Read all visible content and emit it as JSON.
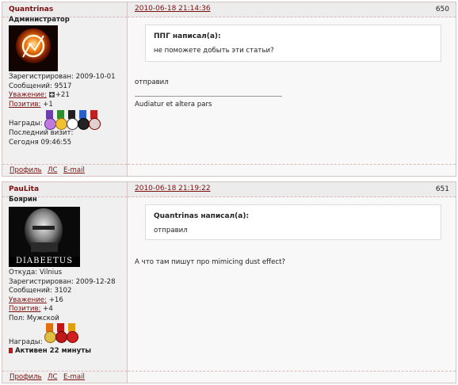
{
  "posts": [
    {
      "username": "Quantrinas",
      "rank": "Администратор",
      "date": "2010-06-18 21:14:36",
      "number": "650",
      "info": {
        "registered": "Зарегистрирован: 2009-10-01",
        "messages": "Сообщений: 9517",
        "respect_label": "Уважение:",
        "respect_value": "+21",
        "positive_label": "Позитив:",
        "positive_value": "+1",
        "awards": "Награды:",
        "last_visit_label": "Последний визит:",
        "last_visit_value": "Сегодня 09:46:55"
      },
      "quote": {
        "title": "ППГ написал(а):",
        "text": "не поможете добыть эти статьи?"
      },
      "message": "отправил",
      "signature": "Audiatur et altera pars",
      "footer": {
        "profile": "Профиль",
        "pm": "ЛС",
        "email": "E-mail"
      }
    },
    {
      "username": "PauLita",
      "rank": "Боярин",
      "date": "2010-06-18 21:19:22",
      "number": "651",
      "avatar_caption": "DIABEETUS",
      "info": {
        "location": "Откуда: Vilnius",
        "registered": "Зарегистрирован: 2009-12-28",
        "messages": "Сообщений: 3102",
        "respect_label": "Уважение:",
        "respect_value": "+16",
        "positive_label": "Позитив:",
        "positive_value": "+4",
        "gender": "Пол: Мужской",
        "awards": "Награды:",
        "active": "Активен 22 минуты"
      },
      "quote": {
        "title": "Quantrinas написал(а):",
        "text": "отправил"
      },
      "message": "А что там пишут про mimicing dust effect?",
      "footer": {
        "profile": "Профиль",
        "pm": "ЛС",
        "email": "E-mail"
      }
    }
  ],
  "colors": {
    "link": "#7a1010",
    "accent_red": "#c01818",
    "border": "#d6c3c3"
  }
}
